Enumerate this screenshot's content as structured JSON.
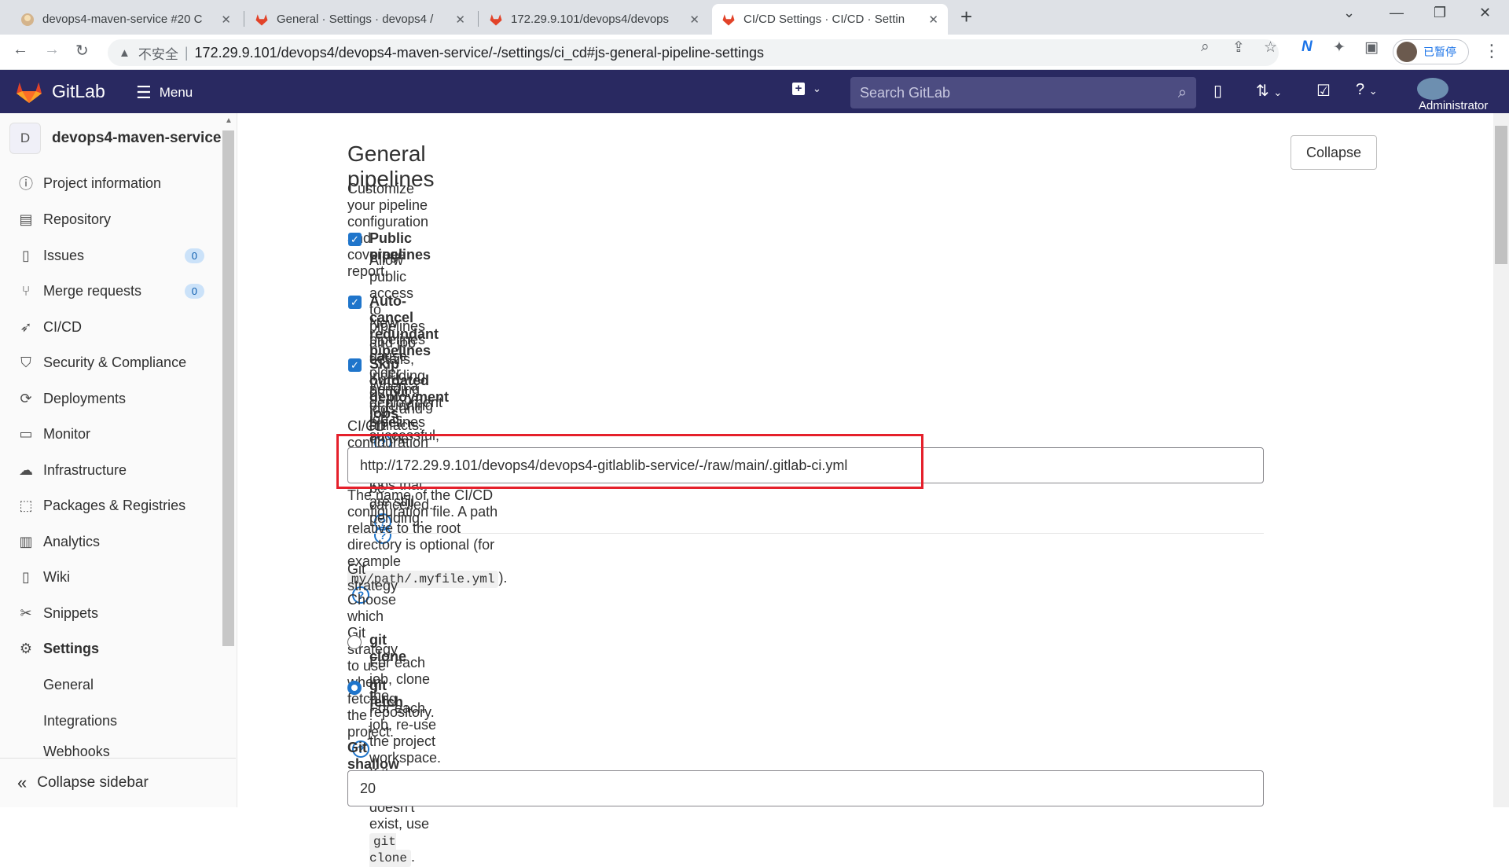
{
  "browser": {
    "tabs": [
      {
        "title": "devops4-maven-service #20 C",
        "active": false
      },
      {
        "title": "General · Settings · devops4 / ",
        "active": false
      },
      {
        "title": "172.29.9.101/devops4/devops",
        "active": false
      },
      {
        "title": "CI/CD Settings · CI/CD · Settin",
        "active": true
      }
    ],
    "insecure_label": "不安全",
    "url": "172.29.9.101/devops4/devops4-maven-service/-/settings/ci_cd#js-general-pipeline-settings",
    "profile_status": "已暂停"
  },
  "header": {
    "logo_text": "GitLab",
    "menu_label": "Menu",
    "search_placeholder": "Search GitLab",
    "user_label": "Administrator"
  },
  "sidebar": {
    "project_initial": "D",
    "project_name": "devops4-maven-service",
    "items": [
      {
        "label": "Project information",
        "icon": "info-icon"
      },
      {
        "label": "Repository",
        "icon": "doc-icon"
      },
      {
        "label": "Issues",
        "icon": "issues-icon",
        "badge": "0"
      },
      {
        "label": "Merge requests",
        "icon": "merge-icon",
        "badge": "0"
      },
      {
        "label": "CI/CD",
        "icon": "rocket-icon"
      },
      {
        "label": "Security & Compliance",
        "icon": "shield-icon"
      },
      {
        "label": "Deployments",
        "icon": "deploy-icon"
      },
      {
        "label": "Monitor",
        "icon": "monitor-icon"
      },
      {
        "label": "Infrastructure",
        "icon": "cloud-icon"
      },
      {
        "label": "Packages & Registries",
        "icon": "package-icon"
      },
      {
        "label": "Analytics",
        "icon": "chart-icon"
      },
      {
        "label": "Wiki",
        "icon": "book-icon"
      },
      {
        "label": "Snippets",
        "icon": "scissors-icon"
      },
      {
        "label": "Settings",
        "icon": "gear-icon"
      }
    ],
    "sub_items": [
      "General",
      "Integrations",
      "Webhooks"
    ],
    "collapse_label": "Collapse sidebar"
  },
  "section": {
    "title": "General pipelines",
    "collapse_label": "Collapse",
    "description": "Customize your pipeline configuration and coverage report.",
    "checkboxes": [
      {
        "label": "Public pipelines",
        "help": "Allow public access to pipelines and job details, including output logs and artifacts.",
        "checked": true
      },
      {
        "label": "Auto-cancel redundant pipelines",
        "help": "New pipelines cause older pending or running pipelines on the same branch to be cancelled.",
        "checked": true
      },
      {
        "label": "Skip outdated deployment jobs",
        "help": "When a deployment job is successful, skip older deployment jobs that are still pending.",
        "checked": true
      }
    ],
    "config_file": {
      "label": "CI/CD configuration file",
      "value": "http://172.29.9.101/devops4/devops4-gitlablib-service/-/raw/main/.gitlab-ci.yml",
      "help_prefix": "The name of the CI/CD configuration file. A path relative to the root directory is optional (for example",
      "help_code": "my/path/.myfile.yml",
      "help_suffix": ")."
    },
    "git_strategy": {
      "title": "Git strategy",
      "description": "Choose which Git strategy to use when fetching the project.",
      "options": [
        {
          "label": "git clone",
          "help": "For each job, clone the repository.",
          "selected": false
        },
        {
          "label": "git fetch",
          "help_prefix": "For each job, re-use the project workspace. If the workspace doesn't exist, use",
          "help_code": "git clone",
          "help_suffix": ".",
          "selected": true
        }
      ]
    },
    "shallow_clone": {
      "label": "Git shallow clone",
      "value": "20"
    }
  },
  "colors": {
    "header_bg": "#292961",
    "accent": "#1f75cb",
    "highlight_box": "#e5202b"
  }
}
